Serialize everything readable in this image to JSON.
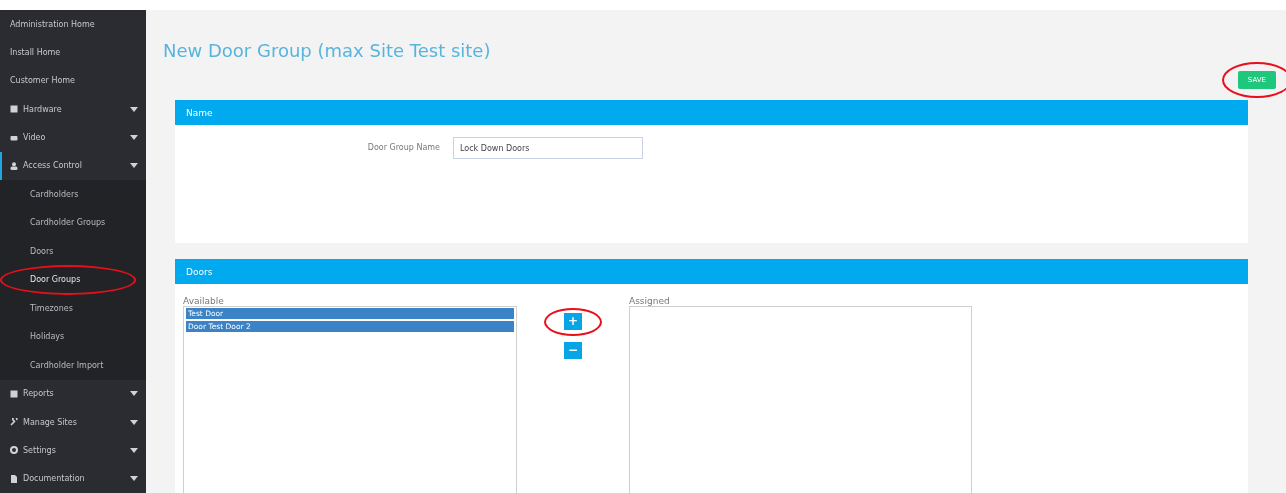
{
  "sidebar": {
    "items": [
      {
        "label": "Administration Home",
        "kind": "link",
        "selected": false
      },
      {
        "label": "Install Home",
        "kind": "link",
        "selected": false
      },
      {
        "label": "Customer Home",
        "kind": "link",
        "selected": false
      },
      {
        "label": "Hardware",
        "kind": "group",
        "selected": false
      },
      {
        "label": "Video",
        "kind": "group",
        "selected": false
      },
      {
        "label": "Access Control",
        "kind": "group",
        "selected": true,
        "children": [
          {
            "label": "Cardholders",
            "selected": false
          },
          {
            "label": "Cardholder Groups",
            "selected": false
          },
          {
            "label": "Doors",
            "selected": false
          },
          {
            "label": "Door Groups",
            "selected": true
          },
          {
            "label": "Timezones",
            "selected": false
          },
          {
            "label": "Holidays",
            "selected": false
          },
          {
            "label": "Cardholder Import",
            "selected": false
          }
        ]
      },
      {
        "label": "Reports",
        "kind": "group",
        "selected": false
      },
      {
        "label": "Manage Sites",
        "kind": "group",
        "selected": false
      },
      {
        "label": "Settings",
        "kind": "group",
        "selected": false
      },
      {
        "label": "Documentation",
        "kind": "group",
        "selected": false
      }
    ]
  },
  "title": "New Door Group (max Site Test site)",
  "save_button": "SAVE",
  "name_panel": {
    "heading": "Name",
    "field_label": "Door Group Name",
    "value": "Lock Down Doors"
  },
  "doors_panel": {
    "heading": "Doors",
    "available": {
      "label": "Available",
      "options": [
        {
          "label": "Test Door",
          "selected": true
        },
        {
          "label": "Door Test Door 2",
          "selected": true
        }
      ]
    },
    "add_button": "+",
    "remove_button": "−",
    "assigned": {
      "label": "Assigned"
    }
  }
}
